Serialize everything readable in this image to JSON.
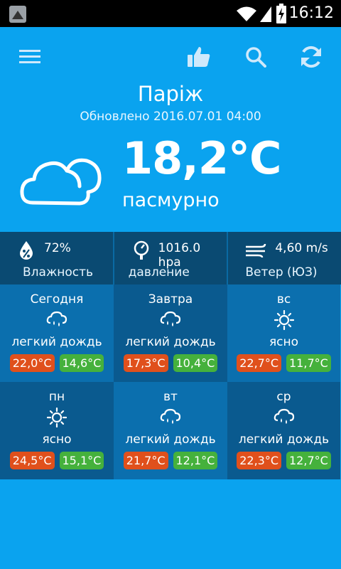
{
  "status_bar": {
    "time": "16:12"
  },
  "header": {
    "city": "Паріж",
    "updated": "Обновлено 2016.07.01 04:00"
  },
  "current": {
    "temperature": "18,2°C",
    "condition": "пасмурно"
  },
  "stats": [
    {
      "icon": "humidity-icon",
      "value": "72%",
      "label": "Влажность"
    },
    {
      "icon": "pressure-gauge-icon",
      "value": "1016.0 hpa",
      "label": "давление"
    },
    {
      "icon": "wind-icon",
      "value": "4,60 m/s",
      "label": "Ветер (ЮЗ)"
    }
  ],
  "forecast": [
    {
      "day": "Сегодня",
      "icon": "rain-cloud-icon",
      "desc": "легкий дождь",
      "high": "22,0°C",
      "low": "14,6°C"
    },
    {
      "day": "Завтра",
      "icon": "rain-cloud-icon",
      "desc": "легкий дождь",
      "high": "17,3°C",
      "low": "10,4°C"
    },
    {
      "day": "вс",
      "icon": "sun-icon",
      "desc": "ясно",
      "high": "22,7°C",
      "low": "11,7°C"
    },
    {
      "day": "пн",
      "icon": "sun-icon",
      "desc": "ясно",
      "high": "24,5°C",
      "low": "15,1°C"
    },
    {
      "day": "вт",
      "icon": "rain-cloud-icon",
      "desc": "легкий дождь",
      "high": "21,7°C",
      "low": "12,1°C"
    },
    {
      "day": "ср",
      "icon": "rain-cloud-icon",
      "desc": "легкий дождь",
      "high": "22,3°C",
      "low": "12,7°C"
    }
  ],
  "colors": {
    "background": "#0aa3ef",
    "high_temp": "#e0501c",
    "low_temp": "#45b13c",
    "stats_bar": "#0a4a72"
  }
}
